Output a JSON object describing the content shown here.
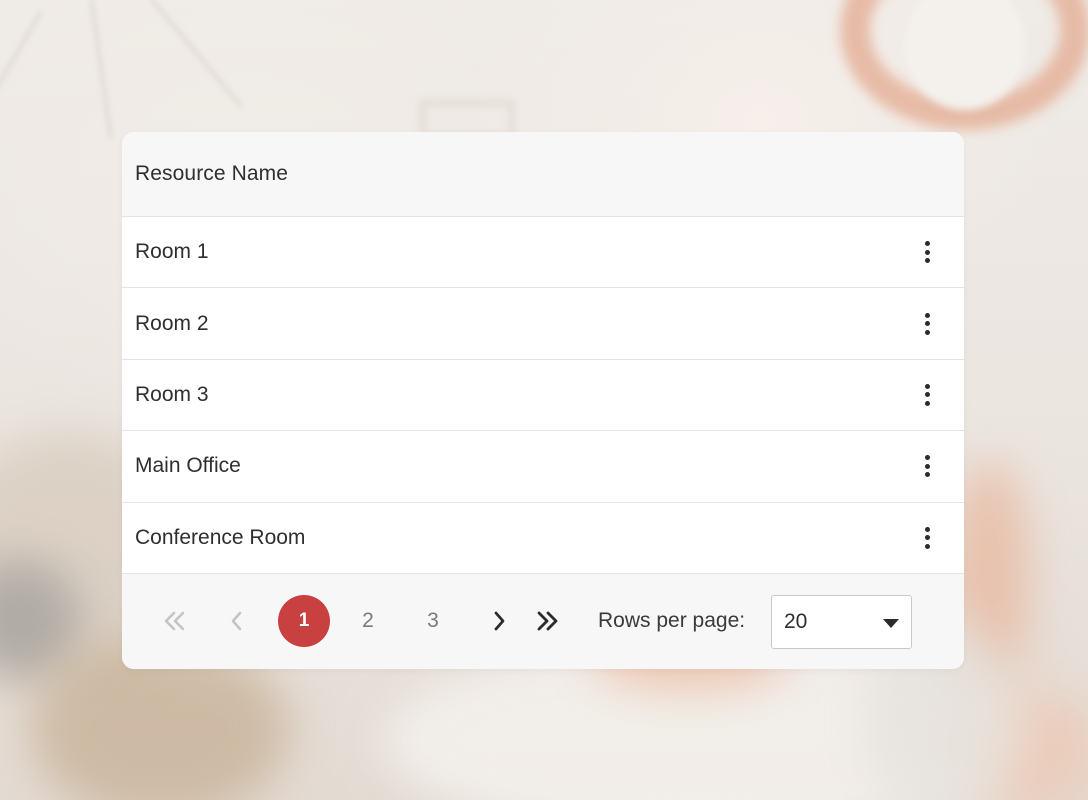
{
  "table": {
    "header": "Resource Name",
    "rows": [
      {
        "label": "Room 1"
      },
      {
        "label": "Room 2"
      },
      {
        "label": "Room 3"
      },
      {
        "label": "Main Office"
      },
      {
        "label": "Conference Room"
      }
    ],
    "row_action_icon": "more-vertical-icon"
  },
  "pagination": {
    "first_icon": "chevrons-double-left-icon",
    "prev_icon": "chevron-left-icon",
    "next_icon": "chevron-right-icon",
    "last_icon": "chevrons-double-right-icon",
    "pages": [
      "1",
      "2",
      "3"
    ],
    "current_page": "1",
    "rows_per_page_label": "Rows per page:",
    "rows_per_page_value": "20"
  },
  "colors": {
    "accent": "#c8403f",
    "header_bg": "#f7f7f7",
    "text": "#2f2f2f",
    "disabled": "#c4c4c4",
    "muted": "#7a7a7a"
  }
}
